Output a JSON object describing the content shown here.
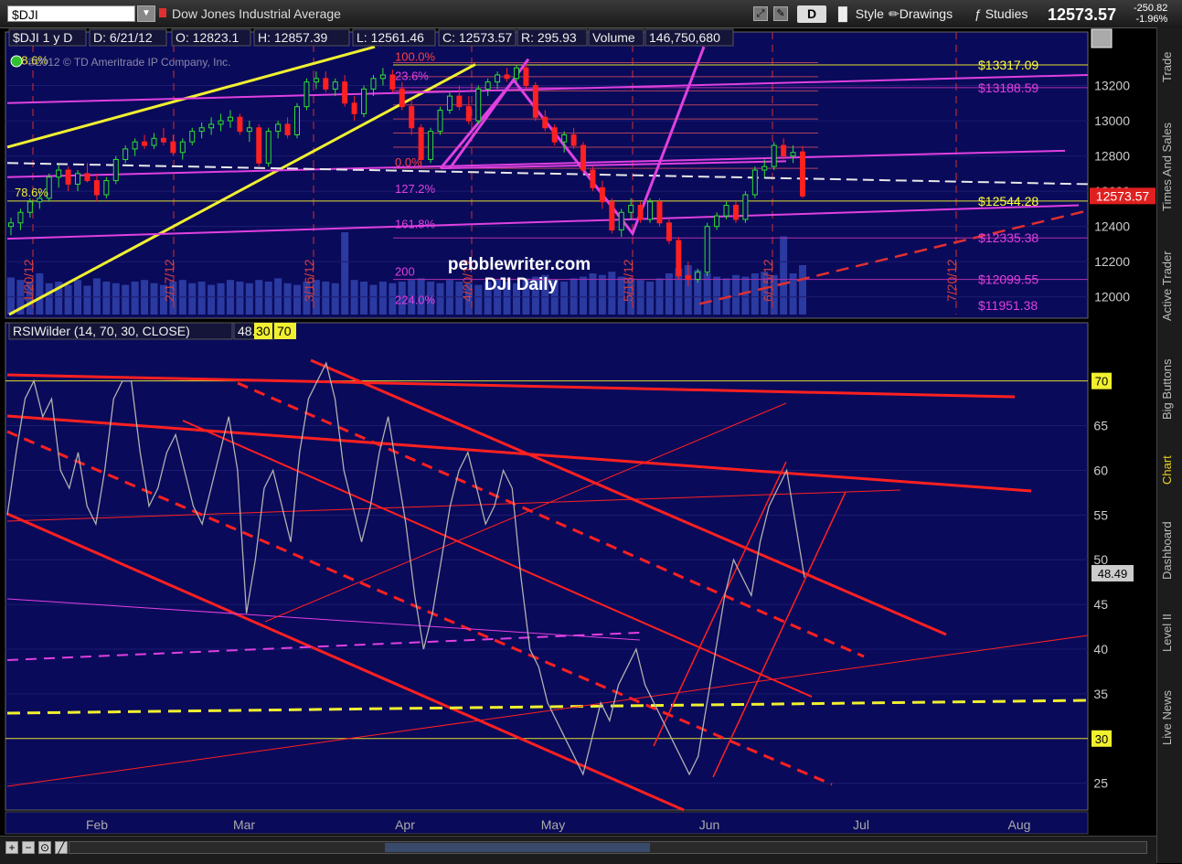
{
  "toolbar": {
    "symbol": "$DJI",
    "description": "Dow Jones Industrial Average",
    "period_btn": "D",
    "style": "Style",
    "drawings": "Drawings",
    "studies": "Studies",
    "last": "12573.57",
    "change": "-250.82",
    "change_pct": "-1.96%"
  },
  "side_tabs": [
    "Trade",
    "Times And Sales",
    "Active Trader",
    "Big Buttons",
    "Chart",
    "Dashboard",
    "Level II",
    "Live News"
  ],
  "chart_data": [
    {
      "type": "candlestick",
      "info_bar": {
        "symbol": "$DJI 1 y D",
        "date": "D: 6/21/12",
        "open": "O: 12823.1",
        "high": "H: 12857.39",
        "low": "L: 12561.46",
        "close": "C: 12573.57",
        "range": "R: 295.93",
        "volume_label": "Volume",
        "volume": "146,750,680"
      },
      "copyright": "©2012 © TD Ameritrade IP Company, Inc.",
      "watermark": [
        "pebblewriter.com",
        "DJI Daily"
      ],
      "ylim": [
        11900,
        13400
      ],
      "yticks": [
        12000,
        12200,
        12400,
        12600,
        12800,
        13000,
        13200
      ],
      "last_price_tag": "12573.57",
      "right_levels": [
        {
          "label": "$13317.09",
          "price": 13317,
          "color": "#ffff30"
        },
        {
          "label": "$13188.59",
          "price": 13188,
          "color": "#e040e0"
        },
        {
          "label": "$12544.28",
          "price": 12544,
          "color": "#ffff30"
        },
        {
          "label": "$12335.38",
          "price": 12335,
          "color": "#e040e0"
        },
        {
          "label": "$12099.55",
          "price": 12099,
          "color": "#e040e0"
        },
        {
          "label": "$11951.38",
          "price": 11951,
          "color": "#e040e0"
        }
      ],
      "fib_left": [
        {
          "label": "100.0%",
          "price": 13330,
          "color": "#ff4040"
        },
        {
          "label": "23.6%",
          "price": 13220,
          "color": "#e040e0"
        },
        {
          "label": "0.0%",
          "price": 12730,
          "color": "#ff4040"
        },
        {
          "label": "127.2%",
          "price": 12580,
          "color": "#e040e0"
        },
        {
          "label": "161.8%",
          "price": 12380,
          "color": "#e040e0"
        },
        {
          "label": "200",
          "price": 12110,
          "color": "#e040e0"
        },
        {
          "label": "224.0%",
          "price": 11950,
          "color": "#e040e0"
        }
      ],
      "left_labels": [
        {
          "label": "78.6%",
          "price": 12570
        },
        {
          "label": "78.6%",
          "price": 13360
        }
      ],
      "date_markers": [
        "1/20/12",
        "2/17/12",
        "3/16/12",
        "4/20/12",
        "5/18/12",
        "6/15/12",
        "7/20/12"
      ],
      "candles": [
        [
          12400,
          12450,
          12350,
          12420
        ],
        [
          12420,
          12500,
          12380,
          12480
        ],
        [
          12480,
          12560,
          12450,
          12540
        ],
        [
          12540,
          12600,
          12500,
          12560
        ],
        [
          12560,
          12700,
          12540,
          12680
        ],
        [
          12680,
          12750,
          12620,
          12720
        ],
        [
          12720,
          12740,
          12600,
          12640
        ],
        [
          12640,
          12720,
          12600,
          12700
        ],
        [
          12700,
          12760,
          12650,
          12660
        ],
        [
          12660,
          12700,
          12540,
          12580
        ],
        [
          12580,
          12680,
          12560,
          12660
        ],
        [
          12660,
          12800,
          12640,
          12780
        ],
        [
          12780,
          12860,
          12760,
          12840
        ],
        [
          12840,
          12900,
          12800,
          12880
        ],
        [
          12880,
          12920,
          12840,
          12860
        ],
        [
          12860,
          12930,
          12840,
          12900
        ],
        [
          12900,
          12960,
          12860,
          12880
        ],
        [
          12880,
          12920,
          12800,
          12820
        ],
        [
          12820,
          12900,
          12780,
          12880
        ],
        [
          12880,
          12960,
          12860,
          12940
        ],
        [
          12940,
          12990,
          12900,
          12960
        ],
        [
          12960,
          13020,
          12920,
          12980
        ],
        [
          12980,
          13040,
          12940,
          13000
        ],
        [
          13000,
          13060,
          12960,
          13020
        ],
        [
          13020,
          13040,
          12920,
          12940
        ],
        [
          12940,
          13000,
          12880,
          12960
        ],
        [
          12960,
          12980,
          12740,
          12760
        ],
        [
          12760,
          12960,
          12740,
          12940
        ],
        [
          12940,
          13000,
          12900,
          12980
        ],
        [
          12980,
          13020,
          12900,
          12920
        ],
        [
          12920,
          13100,
          12900,
          13080
        ],
        [
          13080,
          13240,
          13060,
          13220
        ],
        [
          13220,
          13280,
          13180,
          13240
        ],
        [
          13240,
          13280,
          13160,
          13180
        ],
        [
          13180,
          13240,
          13140,
          13220
        ],
        [
          13220,
          13260,
          13080,
          13100
        ],
        [
          13100,
          13140,
          13000,
          13040
        ],
        [
          13040,
          13200,
          13020,
          13180
        ],
        [
          13180,
          13260,
          13140,
          13240
        ],
        [
          13240,
          13300,
          13200,
          13260
        ],
        [
          13260,
          13290,
          13160,
          13180
        ],
        [
          13180,
          13220,
          13060,
          13080
        ],
        [
          13080,
          13120,
          12920,
          12960
        ],
        [
          12960,
          12980,
          12740,
          12780
        ],
        [
          12780,
          12960,
          12760,
          12940
        ],
        [
          12940,
          13080,
          12920,
          13060
        ],
        [
          13060,
          13160,
          13040,
          13140
        ],
        [
          13140,
          13200,
          13060,
          13080
        ],
        [
          13080,
          13140,
          12980,
          13000
        ],
        [
          13000,
          13200,
          12980,
          13180
        ],
        [
          13180,
          13240,
          13140,
          13220
        ],
        [
          13220,
          13280,
          13180,
          13260
        ],
        [
          13260,
          13300,
          13220,
          13240
        ],
        [
          13240,
          13320,
          13220,
          13300
        ],
        [
          13300,
          13320,
          13180,
          13200
        ],
        [
          13200,
          13220,
          13000,
          13020
        ],
        [
          13020,
          13060,
          12940,
          12960
        ],
        [
          12960,
          12980,
          12860,
          12880
        ],
        [
          12880,
          12940,
          12820,
          12920
        ],
        [
          12920,
          12960,
          12840,
          12860
        ],
        [
          12860,
          12880,
          12700,
          12720
        ],
        [
          12720,
          12740,
          12600,
          12620
        ],
        [
          12620,
          12660,
          12500,
          12540
        ],
        [
          12540,
          12560,
          12360,
          12380
        ],
        [
          12380,
          12500,
          12340,
          12480
        ],
        [
          12480,
          12560,
          12440,
          12520
        ],
        [
          12520,
          12540,
          12420,
          12440
        ],
        [
          12440,
          12560,
          12420,
          12540
        ],
        [
          12540,
          12560,
          12400,
          12420
        ],
        [
          12420,
          12440,
          12300,
          12320
        ],
        [
          12320,
          12340,
          12100,
          12120
        ],
        [
          12120,
          12200,
          12060,
          12100
        ],
        [
          12100,
          12160,
          12080,
          12140
        ],
        [
          12140,
          12420,
          12120,
          12400
        ],
        [
          12400,
          12480,
          12380,
          12460
        ],
        [
          12460,
          12540,
          12440,
          12520
        ],
        [
          12520,
          12540,
          12420,
          12440
        ],
        [
          12440,
          12600,
          12420,
          12580
        ],
        [
          12580,
          12740,
          12560,
          12720
        ],
        [
          12720,
          12780,
          12680,
          12740
        ],
        [
          12740,
          12880,
          12720,
          12860
        ],
        [
          12860,
          12900,
          12780,
          12800
        ],
        [
          12800,
          12860,
          12760,
          12820
        ],
        [
          12823,
          12857,
          12561,
          12573
        ]
      ],
      "volume": [
        0.45,
        0.42,
        0.4,
        0.5,
        0.38,
        0.4,
        0.36,
        0.42,
        0.35,
        0.44,
        0.4,
        0.38,
        0.36,
        0.4,
        0.42,
        0.38,
        0.36,
        0.4,
        0.42,
        0.38,
        0.4,
        0.36,
        0.38,
        0.42,
        0.4,
        0.38,
        0.42,
        0.4,
        0.44,
        0.38,
        0.36,
        0.4,
        0.42,
        0.4,
        0.38,
        1.0,
        0.42,
        0.4,
        0.36,
        0.4,
        0.38,
        0.4,
        0.42,
        0.44,
        0.4,
        0.38,
        0.42,
        0.4,
        0.38,
        0.36,
        0.4,
        0.42,
        0.4,
        0.38,
        0.44,
        0.46,
        0.48,
        0.42,
        0.4,
        0.44,
        0.46,
        0.5,
        0.48,
        0.52,
        0.46,
        0.44,
        0.42,
        0.4,
        0.44,
        0.5,
        0.56,
        0.6,
        0.54,
        0.5,
        0.46,
        0.44,
        0.48,
        0.46,
        0.5,
        0.52,
        0.48,
        0.95,
        0.5,
        0.6
      ]
    },
    {
      "type": "line",
      "title": "RSIWilder (14, 70, 30, CLOSE)",
      "last_value": "48.49",
      "overbought": "30",
      "oversold": "70",
      "ylim": [
        22,
        76
      ],
      "yticks": [
        25,
        30,
        35,
        40,
        45,
        50,
        55,
        60,
        65,
        70
      ],
      "x_labels": [
        "Feb",
        "Mar",
        "Apr",
        "May",
        "Jun",
        "Jul",
        "Aug"
      ],
      "values": [
        55,
        62,
        68,
        70,
        66,
        68,
        60,
        58,
        62,
        56,
        54,
        60,
        68,
        70,
        70,
        62,
        56,
        58,
        62,
        64,
        60,
        56,
        54,
        58,
        62,
        66,
        60,
        44,
        50,
        58,
        60,
        56,
        52,
        62,
        68,
        70,
        72,
        68,
        60,
        56,
        52,
        56,
        62,
        66,
        60,
        54,
        46,
        40,
        44,
        50,
        56,
        60,
        62,
        58,
        54,
        56,
        60,
        58,
        48,
        40,
        38,
        34,
        32,
        30,
        28,
        26,
        30,
        34,
        32,
        36,
        38,
        40,
        36,
        34,
        32,
        30,
        28,
        26,
        28,
        34,
        40,
        46,
        50,
        48,
        46,
        52,
        56,
        58,
        60,
        54,
        48
      ]
    }
  ]
}
